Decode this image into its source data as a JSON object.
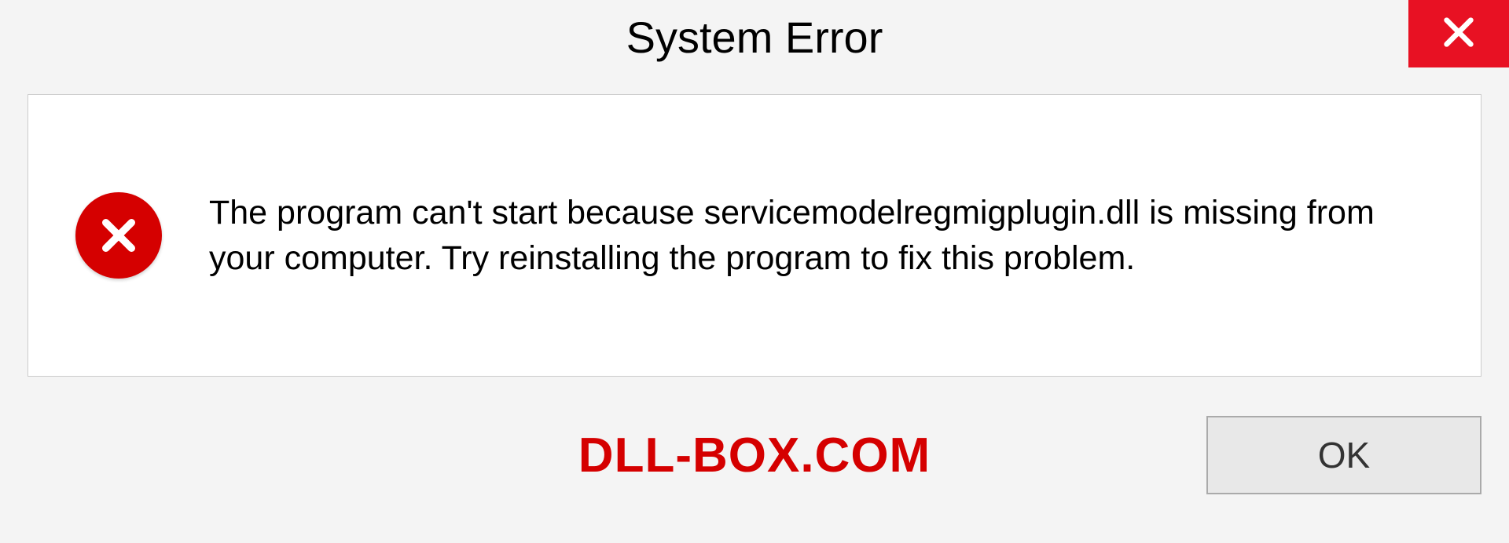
{
  "dialog": {
    "title": "System Error",
    "message": "The program can't start because servicemodelregmigplugin.dll is missing from your computer. Try reinstalling the program to fix this problem.",
    "ok_label": "OK"
  },
  "watermark": "DLL-BOX.COM",
  "colors": {
    "close_bg": "#e81123",
    "error_icon": "#d50000",
    "watermark": "#d50000"
  }
}
